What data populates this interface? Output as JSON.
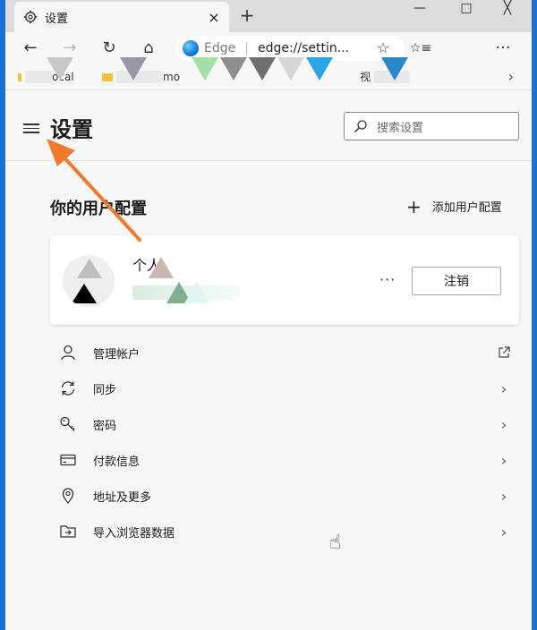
{
  "tab": {
    "title": "设置",
    "icon": "gear-icon",
    "close": "×",
    "new": "+"
  },
  "window": {
    "minimize": "—",
    "maximize": "□",
    "close": "╳"
  },
  "toolbar": {
    "back": "←",
    "forward": "→",
    "refresh": "↻",
    "home": "⌂",
    "address_label": "Edge",
    "address_sep": "|",
    "address_url": "edge://settin...",
    "favorite_star": "☆",
    "favorites_list": "☆≡",
    "more": "···"
  },
  "favbar": {
    "items": [
      "ocal",
      "mo",
      "视"
    ],
    "chevron": "›"
  },
  "page": {
    "title": "设置",
    "search_placeholder": "搜索设置",
    "section_title": "你的用户配置",
    "add_user": "添加用户配置",
    "profile": {
      "name": "个人",
      "more": "···",
      "signout": "注销"
    },
    "menu": [
      {
        "label": "管理帐户",
        "icon": "person-icon",
        "arrow": "external-link-icon"
      },
      {
        "label": "同步",
        "icon": "sync-icon",
        "arrow": "chevron-right-icon"
      },
      {
        "label": "密码",
        "icon": "key-icon",
        "arrow": "chevron-right-icon"
      },
      {
        "label": "付款信息",
        "icon": "credit-card-icon",
        "arrow": "chevron-right-icon"
      },
      {
        "label": "地址及更多",
        "icon": "location-pin-icon",
        "arrow": "chevron-right-icon"
      },
      {
        "label": "导入浏览器数据",
        "icon": "import-folder-icon",
        "arrow": "chevron-right-icon"
      }
    ]
  },
  "colors": {
    "accent_frame": "#1a6fd0",
    "annotation": "#f07a2a"
  }
}
